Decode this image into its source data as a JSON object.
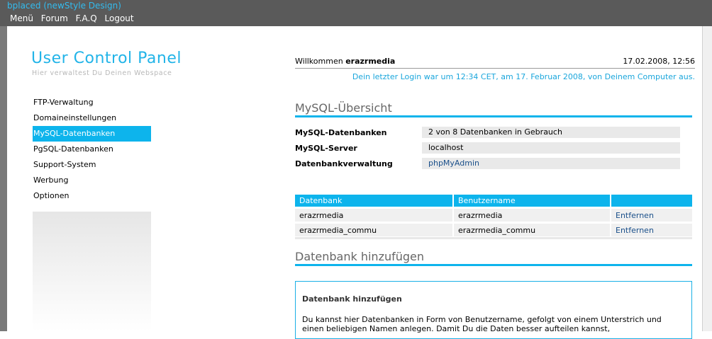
{
  "window": {
    "title": "bplaced (newStyle Design)"
  },
  "topmenu": {
    "items": [
      "Menü",
      "Forum",
      "F.A.Q",
      "Logout"
    ]
  },
  "sidebar": {
    "title": "User Control Panel",
    "subtitle": "Hier verwaltest Du Deinen Webspace",
    "items": [
      {
        "label": "FTP-Verwaltung"
      },
      {
        "label": "Domaineinstellungen"
      },
      {
        "label": "MySQL-Datenbanken"
      },
      {
        "label": "PgSQL-Datenbanken"
      },
      {
        "label": "Support-System"
      },
      {
        "label": "Werbung"
      },
      {
        "label": "Optionen"
      }
    ],
    "active_index": 2
  },
  "header": {
    "welcome_prefix": "Willkommen",
    "username": "erazrmedia",
    "datetime": "17.02.2008, 12:56",
    "last_login": "Dein letzter Login war um 12:34 CET, am 17. Februar 2008, von Deinem Computer aus."
  },
  "overview": {
    "heading": "MySQL-Übersicht",
    "rows": [
      {
        "label": "MySQL-Datenbanken",
        "value": "2 von 8 Datenbanken in Gebrauch"
      },
      {
        "label": "MySQL-Server",
        "value": "localhost"
      },
      {
        "label": "Datenbankverwaltung",
        "value": "phpMyAdmin"
      }
    ]
  },
  "db_table": {
    "columns": [
      "Datenbank",
      "Benutzername",
      ""
    ],
    "rows": [
      {
        "db": "erazrmedia",
        "user": "erazrmedia",
        "action": "Entfernen"
      },
      {
        "db": "erazrmedia_commu",
        "user": "erazrmedia_commu",
        "action": "Entfernen"
      }
    ]
  },
  "add_section": {
    "heading": "Datenbank hinzufügen",
    "box_title": "Datenbank hinzufügen",
    "text": "Du kannst hier Datenbanken in Form von Benutzername, gefolgt von einem Unterstrich und einen beliebigen Namen anlegen. Damit Du die Daten besser aufteilen kannst,"
  },
  "colors": {
    "accent": "#0db4ec",
    "title": "#22b4e8",
    "link": "#1a4f8a",
    "topbar": "#5a5a5a"
  }
}
